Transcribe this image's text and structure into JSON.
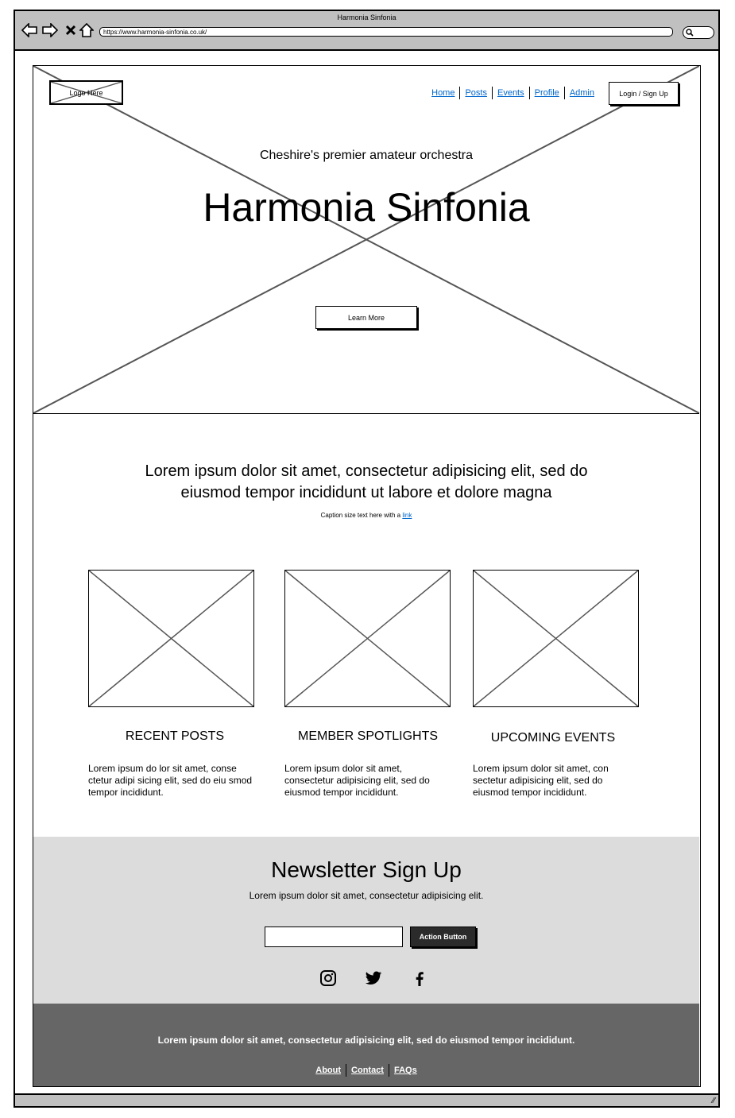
{
  "browser": {
    "title": "Harmonia Sinfonia",
    "url": "https://www.harmonia-sinfonia.co.uk/",
    "icons": [
      "back-arrow-icon",
      "forward-arrow-icon",
      "close-icon",
      "home-icon",
      "search-icon"
    ]
  },
  "header": {
    "logo_label": "Logo Here",
    "nav": [
      "Home",
      "Posts",
      "Events",
      "Profile",
      "Admin"
    ],
    "login_label": "Login / Sign Up"
  },
  "hero": {
    "subtitle": "Cheshire's premier amateur orchestra",
    "title": "Harmonia Sinfonia",
    "button_label": "Learn More"
  },
  "intro": {
    "text": "Lorem ipsum dolor sit amet, consectetur adipisicing elit, sed do eiusmod tempor incididunt ut labore et dolore magna",
    "caption": "Caption size text here with a",
    "caption_link": "link"
  },
  "cards": [
    {
      "title": "RECENT POSTS",
      "body": "Lorem ipsum do lor sit amet, conse ctetur adipi sicing elit, sed do eiu smod tempor incididunt."
    },
    {
      "title": "MEMBER SPOTLIGHTS",
      "body": "Lorem ipsum dolor sit amet, consectetur adipisicing elit, sed do eiusmod tempor incididunt."
    },
    {
      "title": "UPCOMING EVENTS",
      "body": "Lorem ipsum dolor sit amet, con sectetur adipisicing elit, sed do eiusmod tempor incididunt."
    }
  ],
  "newsletter": {
    "title": "Newsletter Sign Up",
    "description": "Lorem ipsum dolor sit amet, consectetur adipisicing elit.",
    "input_value": "",
    "button_label": "Action Button",
    "social_icons": [
      "instagram-icon",
      "twitter-icon",
      "facebook-icon"
    ]
  },
  "footer": {
    "text": "Lorem ipsum dolor sit amet, consectetur adipisicing elit, sed do eiusmod tempor incididunt.",
    "links": [
      "About",
      "Contact",
      "FAQs"
    ]
  }
}
